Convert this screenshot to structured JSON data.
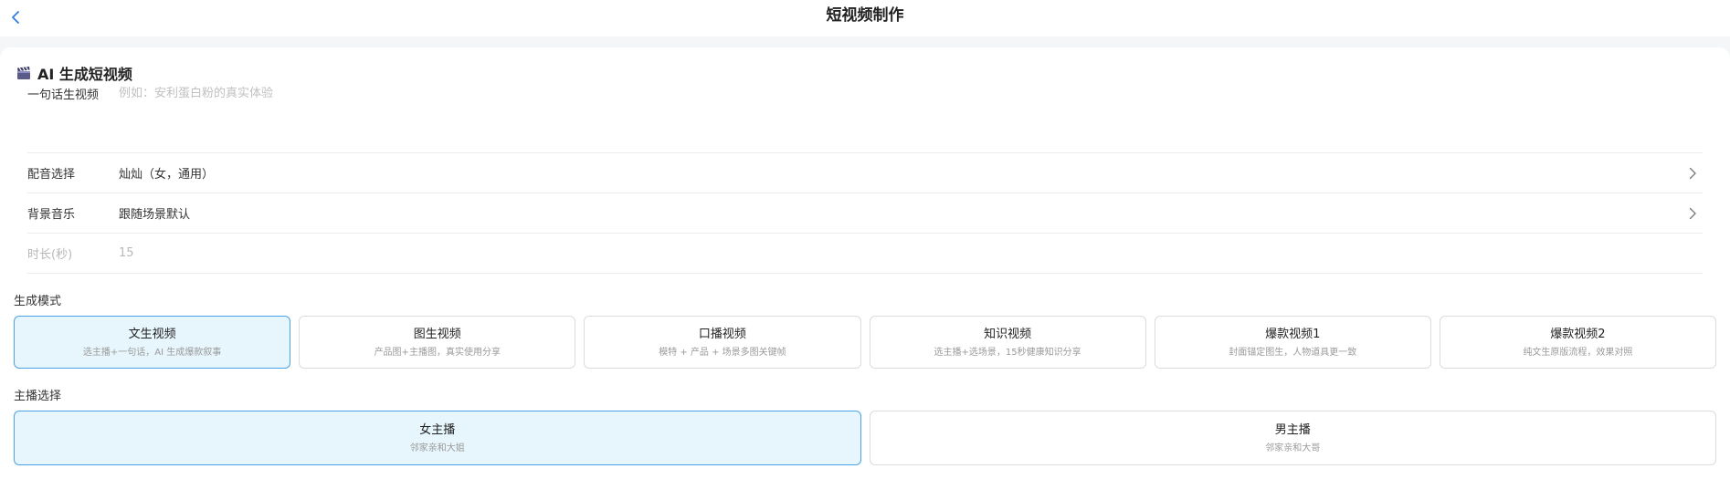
{
  "header": {
    "title": "短视频制作"
  },
  "section": {
    "title": "AI 生成短视频"
  },
  "form": {
    "prompt": {
      "label": "一句话生视频",
      "placeholder": "例如：安利蛋白粉的真实体验",
      "value": ""
    },
    "voice": {
      "label": "配音选择",
      "value": "灿灿（女，通用）"
    },
    "music": {
      "label": "背景音乐",
      "value": "跟随场景默认"
    },
    "duration": {
      "label": "时长(秒)",
      "value": "15"
    }
  },
  "modes": {
    "label": "生成模式",
    "items": [
      {
        "title": "文生视频",
        "desc": "选主播+一句话，AI 生成爆款叙事",
        "selected": true
      },
      {
        "title": "图生视频",
        "desc": "产品图+主播图，真实使用分享",
        "selected": false
      },
      {
        "title": "口播视频",
        "desc": "模特 + 产品 + 场景多图关键帧",
        "selected": false
      },
      {
        "title": "知识视频",
        "desc": "选主播+选场景，15秒健康知识分享",
        "selected": false
      },
      {
        "title": "爆款视频1",
        "desc": "封面锚定图生，人物道具更一致",
        "selected": false
      },
      {
        "title": "爆款视频2",
        "desc": "纯文生原版流程，效果对照",
        "selected": false
      }
    ]
  },
  "anchors": {
    "label": "主播选择",
    "items": [
      {
        "title": "女主播",
        "desc": "邻家亲和大姐",
        "selected": true
      },
      {
        "title": "男主播",
        "desc": "邻家亲和大哥",
        "selected": false
      }
    ]
  },
  "colors": {
    "accent": "#4aa3e8",
    "selected_bg": "#e7f5fc",
    "back_icon": "#2f7de1"
  },
  "icons": {
    "back": "chevron-left-icon",
    "section": "clapperboard-icon",
    "row_arrow": "chevron-right-icon"
  }
}
